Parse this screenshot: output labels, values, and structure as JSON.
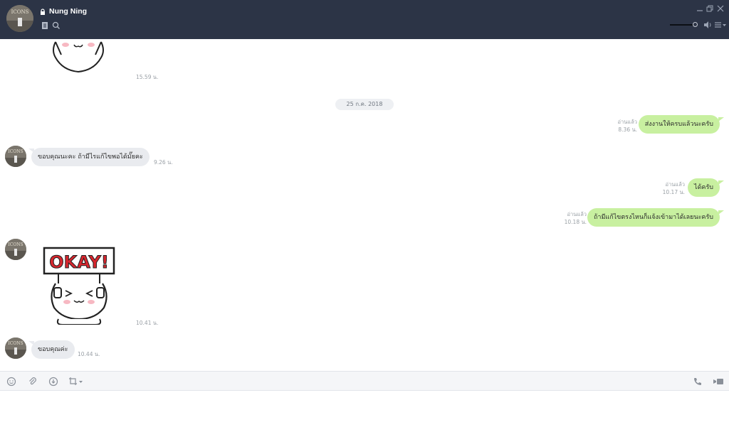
{
  "header": {
    "contact_name": "Nung Ning",
    "avatar_text": "ICONS"
  },
  "date_separator": "25 ก.ค. 2018",
  "messages": [
    {
      "side": "in",
      "type": "sticker",
      "time": "15.59 น."
    },
    {
      "side": "out",
      "type": "text",
      "text": "ส่งงานให้ครบแล้วนะครับ",
      "read": "อ่านแล้ว",
      "time": "8.36 น."
    },
    {
      "side": "in",
      "type": "text",
      "text": "ขอบคุณนะคะ   ถ้ามีไรแก้ไขพอได้มั๊ยคะ",
      "time": "9.26 น."
    },
    {
      "side": "out",
      "type": "text",
      "text": "ได้ครับ",
      "read": "อ่านแล้ว",
      "time": "10.17 น."
    },
    {
      "side": "out",
      "type": "text",
      "text": "ถ้ามีแก้ไขตรงไหนก็แจ้งเข้ามาได้เลยนะครับ",
      "read": "อ่านแล้ว",
      "time": "10.18 น."
    },
    {
      "side": "in",
      "type": "sticker",
      "sticker_text": "OKAY!",
      "time": "10.41 น."
    },
    {
      "side": "in",
      "type": "text",
      "text": "ขอบคุณค่ะ",
      "time": "10.44 น."
    }
  ],
  "colors": {
    "header_bg": "#2c3446",
    "outgoing_bubble": "#c8f0a0",
    "incoming_bubble": "#e9ebef",
    "sticker_red": "#d7262e"
  },
  "icons": {
    "header": [
      "lock-icon",
      "notes-icon",
      "search-icon",
      "minimize-icon",
      "restore-icon",
      "close-icon",
      "volume-icon",
      "menu-icon"
    ],
    "toolbar": [
      "emoji-icon",
      "attach-icon",
      "save-icon",
      "screenshot-icon",
      "call-icon",
      "video-icon"
    ]
  }
}
